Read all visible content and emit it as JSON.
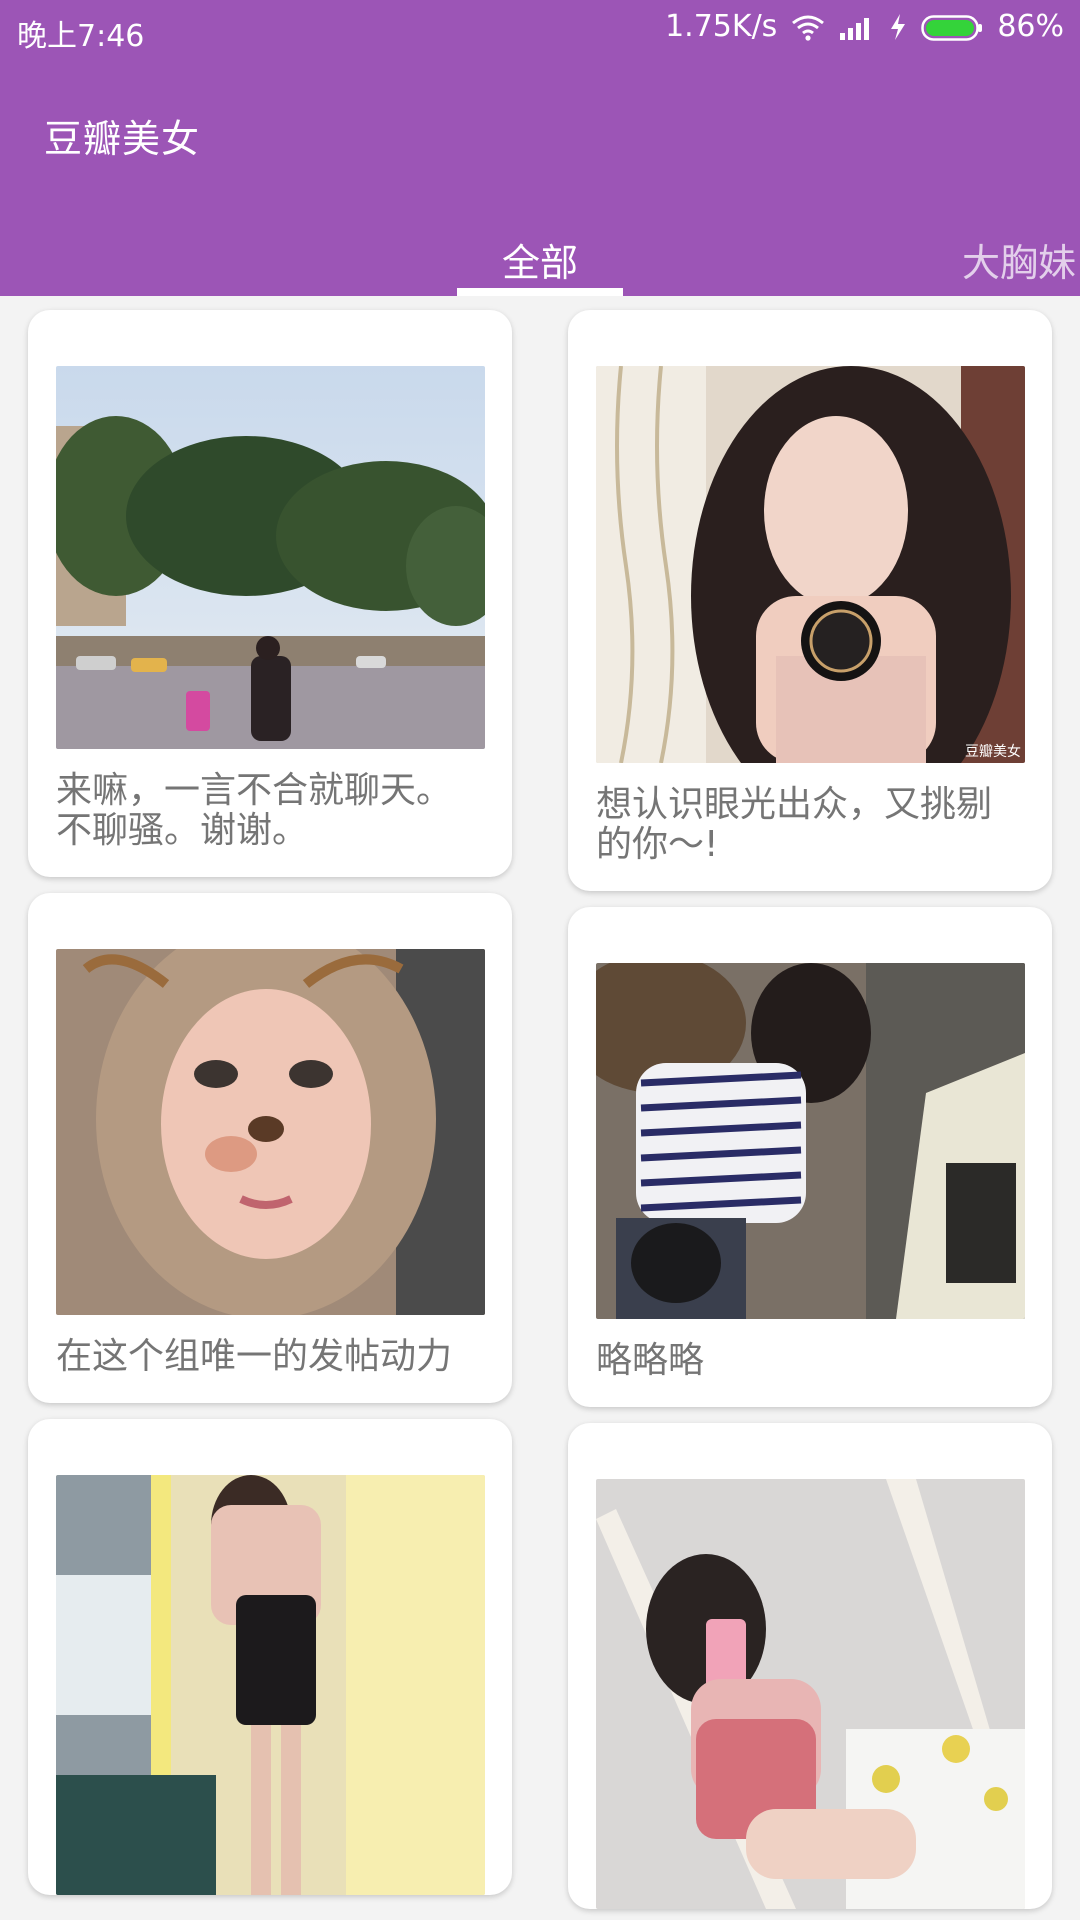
{
  "status_bar": {
    "time": "晚上7:46",
    "speed": "1.75K/s",
    "battery_percent": "86%",
    "icons": [
      "wifi-icon",
      "signal-icon",
      "charging-bolt-icon",
      "battery-icon"
    ]
  },
  "app": {
    "title": "豆瓣美女",
    "accent_color": "#9c55b6"
  },
  "tabs": [
    {
      "label": "全部",
      "selected": true
    },
    {
      "label": "大胸妹",
      "selected": false
    }
  ],
  "feed": {
    "left": [
      {
        "caption": "来嘛，一言不合就聊天。不聊骚。谢谢。",
        "photo": "street-scene-photo"
      },
      {
        "caption": "在这个组唯一的发帖动力",
        "photo": "deer-filter-selfie-photo"
      },
      {
        "caption": "",
        "photo": "mirror-selfie-photo"
      }
    ],
    "right": [
      {
        "caption": "想认识眼光出众，又挑剔的你～!",
        "photo": "cushion-compact-photo",
        "watermark": "豆瓣美女"
      },
      {
        "caption": "略略略",
        "photo": "striped-shirt-photo"
      },
      {
        "caption": "",
        "photo": "bedroom-mirror-photo"
      }
    ]
  }
}
